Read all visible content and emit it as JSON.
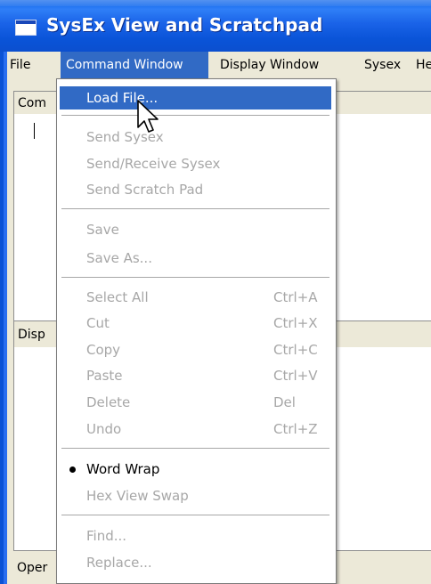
{
  "window": {
    "title": "SysEx View and Scratchpad"
  },
  "menu_bar": {
    "items": [
      {
        "label": "File"
      },
      {
        "label": "Command Window"
      },
      {
        "label": "Display Window"
      },
      {
        "label": "Sysex"
      },
      {
        "label": "He"
      }
    ]
  },
  "panes": {
    "command_header": "Com",
    "display_header": "Disp",
    "status_text": "Oper"
  },
  "dropdown": {
    "items": [
      {
        "label": "Load File...",
        "shortcut": "",
        "enabled": true,
        "highlighted": true
      },
      {
        "label": "Send Sysex",
        "shortcut": "",
        "enabled": false
      },
      {
        "label": "Send/Receive Sysex",
        "shortcut": "",
        "enabled": false
      },
      {
        "label": "Send Scratch Pad",
        "shortcut": "",
        "enabled": false
      },
      {
        "label": "Save",
        "shortcut": "",
        "enabled": false
      },
      {
        "label": "Save As...",
        "shortcut": "",
        "enabled": false
      },
      {
        "label": "Select All",
        "shortcut": "Ctrl+A",
        "enabled": false
      },
      {
        "label": "Cut",
        "shortcut": "Ctrl+X",
        "enabled": false
      },
      {
        "label": "Copy",
        "shortcut": "Ctrl+C",
        "enabled": false
      },
      {
        "label": "Paste",
        "shortcut": "Ctrl+V",
        "enabled": false
      },
      {
        "label": "Delete",
        "shortcut": "Del",
        "enabled": false
      },
      {
        "label": "Undo",
        "shortcut": "Ctrl+Z",
        "enabled": false
      },
      {
        "label": "Word Wrap",
        "shortcut": "",
        "enabled": true,
        "checked": true
      },
      {
        "label": "Hex View Swap",
        "shortcut": "",
        "enabled": false
      },
      {
        "label": "Find...",
        "shortcut": "",
        "enabled": false
      },
      {
        "label": "Replace...",
        "shortcut": "",
        "enabled": false
      }
    ]
  },
  "colors": {
    "title_bar": "#0a54d8",
    "menu_highlight": "#316ac5",
    "disabled_text": "#a7a7a7",
    "window_face": "#ece9d8"
  }
}
